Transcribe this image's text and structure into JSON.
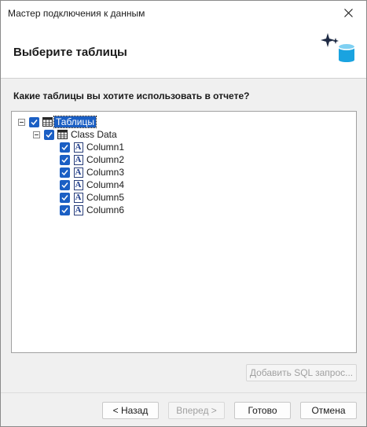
{
  "window": {
    "title": "Мастер подключения к данным"
  },
  "header": {
    "heading": "Выберите таблицы",
    "icon": "sparkle-database-icon"
  },
  "question": "Какие таблицы вы хотите использовать в отчете?",
  "tree": {
    "root": {
      "label": "Таблицы",
      "checked": true,
      "expanded": true,
      "selected": true,
      "icon": "table-icon"
    },
    "table": {
      "label": "Class Data",
      "checked": true,
      "expanded": true,
      "icon": "table-icon"
    },
    "columns": [
      {
        "label": "Column1",
        "checked": true,
        "icon": "text-column-icon"
      },
      {
        "label": "Column2",
        "checked": true,
        "icon": "text-column-icon"
      },
      {
        "label": "Column3",
        "checked": true,
        "icon": "text-column-icon"
      },
      {
        "label": "Column4",
        "checked": true,
        "icon": "text-column-icon"
      },
      {
        "label": "Column5",
        "checked": true,
        "icon": "text-column-icon"
      },
      {
        "label": "Column6",
        "checked": true,
        "icon": "text-column-icon"
      }
    ]
  },
  "buttons": {
    "add_sql": "Добавить SQL запрос...",
    "back": "< Назад",
    "next": "Вперед >",
    "finish": "Готово",
    "cancel": "Отмена"
  },
  "colors": {
    "accent": "#1b5fc4",
    "disabled_text": "#a0a0a0"
  }
}
